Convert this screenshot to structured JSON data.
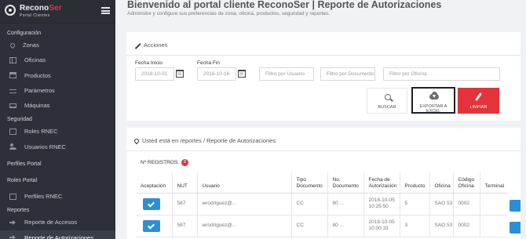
{
  "brand": {
    "name_part1": "Recono",
    "name_part2": "Ser",
    "subtitle": "Portal Clientes"
  },
  "sidebar": {
    "sections": [
      {
        "title": "Configuración",
        "items": [
          {
            "label": "Zonas",
            "icon": "map-marker-icon"
          },
          {
            "label": "Oficinas",
            "icon": "building-icon"
          },
          {
            "label": "Productos",
            "icon": "box-icon"
          },
          {
            "label": "Parámetros",
            "icon": "sliders-icon"
          },
          {
            "label": "Máquinas",
            "icon": "laptop-icon"
          }
        ]
      },
      {
        "title": "Seguridad",
        "items": [
          {
            "label": "Roles RNEC",
            "icon": "id-card-icon"
          },
          {
            "label": "Usuarios RNEC",
            "icon": "users-icon"
          }
        ]
      },
      {
        "title": "Perfiles Portal",
        "items": []
      },
      {
        "title": "Roles Portal",
        "items": [
          {
            "label": "Perfiles RNEC",
            "icon": "id-card-icon"
          }
        ]
      },
      {
        "title": "Reportes",
        "items": [
          {
            "label": "Reporte de Accesos",
            "icon": "sign-in-icon"
          },
          {
            "label": "Reporte de Autorizaciones",
            "icon": "sign-in-icon"
          }
        ]
      }
    ]
  },
  "header": {
    "title": "Bienvenido al portal cliente ReconoSer | Reporte de Autorizaciones",
    "subtitle": "Administre y configure sus preferencias de zona, oficina, productos, seguridad y reportes."
  },
  "acciones": {
    "title": "Acciones",
    "fecha_inicio_label": "Fecha Inicio",
    "fecha_inicio_value": "2018-10-01",
    "fecha_fin_label": "Fecha Fin",
    "fecha_fin_value": "2018-10-16",
    "usuario_placeholder": "Filtro por Usuario",
    "documento_placeholder": "Filtro por Documento",
    "oficina_placeholder": "Filtro por Oficina",
    "buscar_label": "BUSCAR",
    "exportar_label": "EXPORTAR A EXCEL",
    "limpiar_label": "LIMPIAR"
  },
  "reporte": {
    "breadcrumb": "Usted está en reportes / Reporte de Autorizaciones",
    "registros_label": "Nº REGISTROS:",
    "registros_count": "8",
    "columns": [
      "Aceptación",
      "NUT",
      "Usuario",
      "Tipo Documento",
      "No. Documento",
      "Fecha de Autorización",
      "Producto",
      "Oficina",
      "Código Oficina",
      "Terminal"
    ],
    "rows": [
      {
        "nut": "587",
        "usuario": "wrodriguez@...",
        "tipo": "CC",
        "documento": "80 ...",
        "fecha": "2018-10-05 10:25:50",
        "producto": "5",
        "oficina": "SAO 53",
        "codigo": "0002",
        "terminal": ""
      },
      {
        "nut": "587",
        "usuario": "wrodriguez@...",
        "tipo": "CC",
        "documento": "80 ...",
        "fecha": "2018-10-05 10:00:33",
        "producto": "3",
        "oficina": "SAO 53",
        "codigo": "0002",
        "terminal": ""
      }
    ]
  },
  "colors": {
    "sidebar_bg": "#2d3038",
    "accent_red": "#e5333b",
    "accent_blue": "#2b8fd6",
    "page_bg": "#f1f2f6"
  }
}
